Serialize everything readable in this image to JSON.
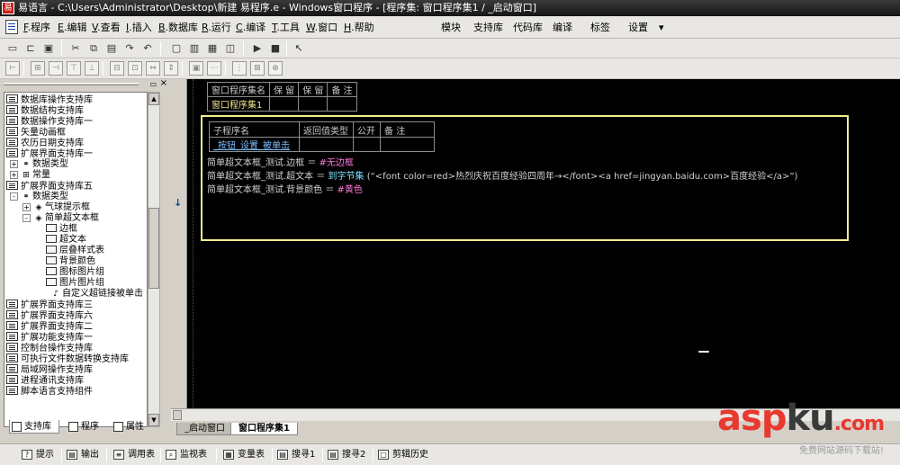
{
  "window": {
    "title": "易语言 - C:\\Users\\Administrator\\Desktop\\新建 易程序.e - Windows窗口程序 - [程序集: 窗口程序集1 / _启动窗口]"
  },
  "menu": {
    "items": [
      {
        "key": "F",
        "label": "程序"
      },
      {
        "key": "E",
        "label": "编辑"
      },
      {
        "key": "V",
        "label": "查看"
      },
      {
        "key": "I",
        "label": "插入"
      },
      {
        "key": "B",
        "label": "数据库"
      },
      {
        "key": "R",
        "label": "运行"
      },
      {
        "key": "C",
        "label": "编译"
      },
      {
        "key": "T",
        "label": "工具"
      },
      {
        "key": "W",
        "label": "窗口"
      },
      {
        "key": "H",
        "label": "帮助"
      }
    ],
    "right": [
      "模块",
      "支持库",
      "代码库",
      "编译",
      "标签",
      "设置"
    ],
    "dropdown_arrow": "▾"
  },
  "toolbar1": {
    "icons": [
      "new-icon",
      "open-icon",
      "save-icon",
      "cut-icon",
      "copy-icon",
      "paste-icon",
      "redo-icon",
      "undo-icon",
      "window-icon",
      "layout-icon",
      "panel-icon",
      "run-icon",
      "stop-icon",
      "cursor-icon"
    ],
    "run_glyph": "▶",
    "stop_glyph": "■"
  },
  "tree": {
    "items": [
      {
        "label": "数据库操作支持库",
        "kind": "lib",
        "level": 0
      },
      {
        "label": "数据结构支持库",
        "kind": "lib",
        "level": 0
      },
      {
        "label": "数据操作支持库一",
        "kind": "lib",
        "level": 0
      },
      {
        "label": "矢量动画框",
        "kind": "lib",
        "level": 0
      },
      {
        "label": "农历日期支持库",
        "kind": "lib",
        "level": 0
      },
      {
        "label": "扩展界面支持库一",
        "kind": "lib",
        "level": 0
      },
      {
        "label": "数据类型",
        "kind": "group",
        "level": 1,
        "expander": "+"
      },
      {
        "label": "常量",
        "kind": "group",
        "level": 1,
        "expander": "+"
      },
      {
        "label": "扩展界面支持库五",
        "kind": "lib",
        "level": 0
      },
      {
        "label": "数据类型",
        "kind": "group",
        "level": 1,
        "expander": "-"
      },
      {
        "label": "气球提示框",
        "kind": "type",
        "level": 2,
        "expander": "+"
      },
      {
        "label": "简单超文本框",
        "kind": "type",
        "level": 2,
        "expander": "-"
      },
      {
        "label": "边框",
        "kind": "prop",
        "level": 3
      },
      {
        "label": "超文本",
        "kind": "prop",
        "level": 3
      },
      {
        "label": "层叠样式表",
        "kind": "prop",
        "level": 3
      },
      {
        "label": "背景颜色",
        "kind": "prop",
        "level": 3
      },
      {
        "label": "图标图片组",
        "kind": "prop",
        "level": 3
      },
      {
        "label": "图片图片组",
        "kind": "prop",
        "level": 3
      },
      {
        "label": "自定义超链接被单击",
        "kind": "event",
        "level": 3
      },
      {
        "label": "扩展界面支持库三",
        "kind": "lib",
        "level": 0
      },
      {
        "label": "扩展界面支持库六",
        "kind": "lib",
        "level": 0
      },
      {
        "label": "扩展界面支持库二",
        "kind": "lib",
        "level": 0
      },
      {
        "label": "扩展功能支持库一",
        "kind": "lib",
        "level": 0
      },
      {
        "label": "控制台操作支持库",
        "kind": "lib",
        "level": 0
      },
      {
        "label": "可执行文件数据转换支持库",
        "kind": "lib",
        "level": 0
      },
      {
        "label": "局域网操作支持库",
        "kind": "lib",
        "level": 0
      },
      {
        "label": "进程通讯支持库",
        "kind": "lib",
        "level": 0
      },
      {
        "label": "脚本语言支持组件",
        "kind": "lib",
        "level": 0
      }
    ]
  },
  "left_tabs": [
    {
      "label": "支持库",
      "active": true
    },
    {
      "label": "程序",
      "active": false
    },
    {
      "label": "属性",
      "active": false
    }
  ],
  "assembly_table": {
    "headers": [
      "窗口程序集名",
      "保 留",
      "保 留",
      "备 注"
    ],
    "row": [
      "窗口程序集1",
      "",
      "",
      ""
    ]
  },
  "sub_table": {
    "headers": [
      "子程序名",
      "返回值类型",
      "公开",
      "备 注"
    ],
    "row": [
      "_按钮_设置_被单击",
      "",
      "",
      ""
    ]
  },
  "code_lines": [
    {
      "obj": "简单超文本框_测试.边框",
      "op": " ＝ ",
      "value": "#无边框",
      "fn": "",
      "arg": ""
    },
    {
      "obj": "简单超文本框_测试.超文本",
      "op": " ＝ ",
      "value": "",
      "fn": "到字节集",
      "arg": " (“<font color=red>热烈庆祝百度经验四周年→</font><a href=jingyan.baidu.com>百度经验</a>”)"
    },
    {
      "obj": "简单超文本框_测试.背景颜色",
      "op": " ＝ ",
      "value": "#黄色",
      "fn": "",
      "arg": ""
    }
  ],
  "doc_tabs": [
    {
      "label": "_启动窗口",
      "active": false
    },
    {
      "label": "窗口程序集1",
      "active": true
    }
  ],
  "status": {
    "items": [
      "提示",
      "输出",
      "调用表",
      "监视表",
      "变量表",
      "搜寻1",
      "搜寻2",
      "剪辑历史"
    ]
  },
  "watermark": {
    "logo_a": "asp",
    "logo_k": "ku",
    "logo_dom": ".com",
    "sub": "免费网站源码下载站!"
  },
  "colors": {
    "editor_bg": "#000000",
    "highlight_border": "#f3f08a",
    "constant": "#ff7ad9",
    "function": "#7de0ff",
    "brand": "#e8392f"
  }
}
